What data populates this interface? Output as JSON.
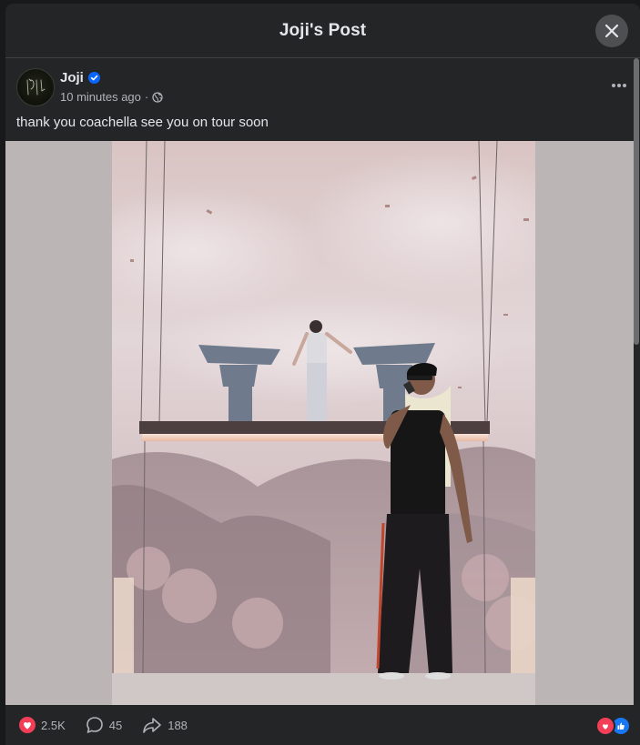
{
  "modal": {
    "title": "Joji's Post"
  },
  "post": {
    "author": "Joji",
    "avatar_text": "JOJI",
    "timestamp": "10 minutes ago",
    "separator": "·",
    "privacy_icon": "globe-icon",
    "verified_icon": "verified-badge-icon",
    "text": "thank you coachella see you on tour soon"
  },
  "stats": {
    "reactions": "2.5K",
    "comments": "45",
    "shares": "188"
  },
  "colors": {
    "background": "#242526",
    "text_primary": "#e4e6eb",
    "text_secondary": "#b0b3b8",
    "verified_blue": "#0866ff",
    "love_red": "#f33e58",
    "like_blue": "#1877f2"
  }
}
